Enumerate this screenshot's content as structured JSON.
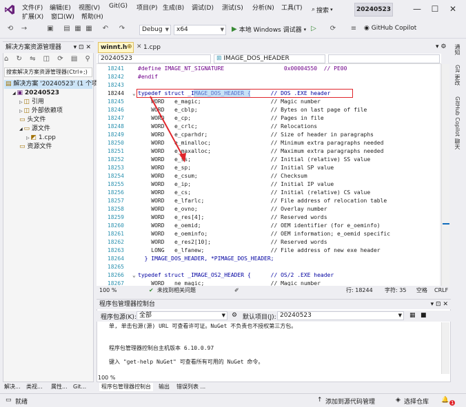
{
  "menubar": {
    "items_row1": [
      "文件(F)",
      "编辑(E)",
      "视图(V)",
      "Git(G)",
      "项目(P)",
      "生成(B)",
      "调试(D)",
      "测试(S)",
      "分析(N)",
      "工具(T)"
    ],
    "items_row2": [
      "扩展(X)",
      "窗口(W)",
      "帮助(H)"
    ],
    "search_label": "搜索",
    "solution_name": "20240523",
    "window_buttons": [
      "—",
      "☐",
      "✕"
    ]
  },
  "toolbar": {
    "config": "Debug",
    "platform": "x64",
    "run_label": "本地 Windows 调试器",
    "copilot_label": "GitHub Copilot"
  },
  "solution_explorer": {
    "title": "解决方案资源管理器",
    "search_placeholder": "搜索解决方案资源管理器(Ctrl+;)",
    "items": [
      {
        "label": "解决方案 '20240523' (1 个项目)",
        "indent": 0
      },
      {
        "label": "20240523",
        "indent": 1
      },
      {
        "label": "引用",
        "indent": 2
      },
      {
        "label": "外部依赖项",
        "indent": 2
      },
      {
        "label": "头文件",
        "indent": 2
      },
      {
        "label": "源文件",
        "indent": 2
      },
      {
        "label": "1.cpp",
        "indent": 3
      },
      {
        "label": "资源文件",
        "indent": 2
      }
    ],
    "bottom_tabs": [
      "解决...",
      "类视...",
      "属性...",
      "Git..."
    ]
  },
  "editor": {
    "tabs": [
      {
        "label": "winnt.h",
        "active": true
      },
      {
        "label": "1.cpp",
        "active": false
      }
    ],
    "nav_project": "20240523",
    "nav_scope": "IMAGE_DOS_HEADER",
    "lines": [
      {
        "num": "18241",
        "text": "#define IMAGE_NT_SIGNATURE                  0x00004550  // PE00",
        "kind": "macro"
      },
      {
        "num": "18242",
        "text": "#endif",
        "kind": "macro"
      },
      {
        "num": "18243",
        "text": "",
        "kind": "plain"
      },
      {
        "num": "18244",
        "text": "typedef struct _IMAGE_DOS_HEADER {      // DOS .EXE header",
        "kind": "typedef"
      },
      {
        "num": "18245",
        "text": "    WORD   e_magic;                     // Magic number",
        "kind": "field"
      },
      {
        "num": "18246",
        "text": "    WORD   e_cblp;                      // Bytes on last page of file",
        "kind": "field"
      },
      {
        "num": "18247",
        "text": "    WORD   e_cp;                        // Pages in file",
        "kind": "field"
      },
      {
        "num": "18248",
        "text": "    WORD   e_crlc;                      // Relocations",
        "kind": "field"
      },
      {
        "num": "18249",
        "text": "    WORD   e_cparhdr;                   // Size of header in paragraphs",
        "kind": "field"
      },
      {
        "num": "18250",
        "text": "    WORD   e_minalloc;                  // Minimum extra paragraphs needed",
        "kind": "field"
      },
      {
        "num": "18251",
        "text": "    WORD   e_maxalloc;                  // Maximum extra paragraphs needed",
        "kind": "field"
      },
      {
        "num": "18252",
        "text": "    WORD   e_ss;                        // Initial (relative) SS value",
        "kind": "field"
      },
      {
        "num": "18253",
        "text": "    WORD   e_sp;                        // Initial SP value",
        "kind": "field"
      },
      {
        "num": "18254",
        "text": "    WORD   e_csum;                      // Checksum",
        "kind": "field"
      },
      {
        "num": "18255",
        "text": "    WORD   e_ip;                        // Initial IP value",
        "kind": "field"
      },
      {
        "num": "18256",
        "text": "    WORD   e_cs;                        // Initial (relative) CS value",
        "kind": "field"
      },
      {
        "num": "18257",
        "text": "    WORD   e_lfarlc;                    // File address of relocation table",
        "kind": "field"
      },
      {
        "num": "18258",
        "text": "    WORD   e_ovno;                      // Overlay number",
        "kind": "field"
      },
      {
        "num": "18259",
        "text": "    WORD   e_res[4];                    // Reserved words",
        "kind": "field"
      },
      {
        "num": "18260",
        "text": "    WORD   e_oemid;                     // OEM identifier (for e_oeminfo)",
        "kind": "field"
      },
      {
        "num": "18261",
        "text": "    WORD   e_oeminfo;                   // OEM information; e_oemid specific",
        "kind": "field"
      },
      {
        "num": "18262",
        "text": "    WORD   e_res2[10];                  // Reserved words",
        "kind": "field"
      },
      {
        "num": "18263",
        "text": "    LONG   e_lfanew;                    // File address of new exe header",
        "kind": "field"
      },
      {
        "num": "18264",
        "text": "  } IMAGE_DOS_HEADER, *PIMAGE_DOS_HEADER;",
        "kind": "close"
      },
      {
        "num": "18265",
        "text": "",
        "kind": "plain"
      },
      {
        "num": "18266",
        "text": "typedef struct _IMAGE_OS2_HEADER {      // OS/2 .EXE header",
        "kind": "typedef"
      },
      {
        "num": "18267",
        "text": "    WORD   ne_magic;                    // Magic number",
        "kind": "field"
      }
    ],
    "zoom": "100 %",
    "issues": "未找到相关问题",
    "line_col": "行: 18244",
    "char": "字符: 35",
    "tab_mode": "空格",
    "eol": "CRLF"
  },
  "package_console": {
    "title": "程序包管理器控制台",
    "source_label": "程序包源(K):",
    "source_value": "全部",
    "project_label": "默认项目(J):",
    "project_value": "20240523",
    "lines": [
      "单, 单击包源(源) URL 可查看许可证。NuGet 不负责也不授权第三方包。",
      "",
      "程序包管理器控制台主机版本 6.10.0.97",
      "",
      "键入 \"get-help NuGet\" 可查看所有可用的 NuGet 命令。"
    ],
    "zoom": "100 %",
    "bottom_tabs": [
      "程序包管理器控制台",
      "输出",
      "错误列表 ..."
    ]
  },
  "right_rail": {
    "items": [
      "通知",
      "Git 更改",
      "GitHub Copilot 聊天"
    ]
  },
  "statusbar": {
    "ready": "就绪",
    "add_source": "添加到源代码管理",
    "select_repo": "选择仓库",
    "notif_count": "1"
  },
  "colors": {
    "accent": "#68217a",
    "highlight_red": "#e0252b",
    "selection_blue": "#99c9ef"
  }
}
